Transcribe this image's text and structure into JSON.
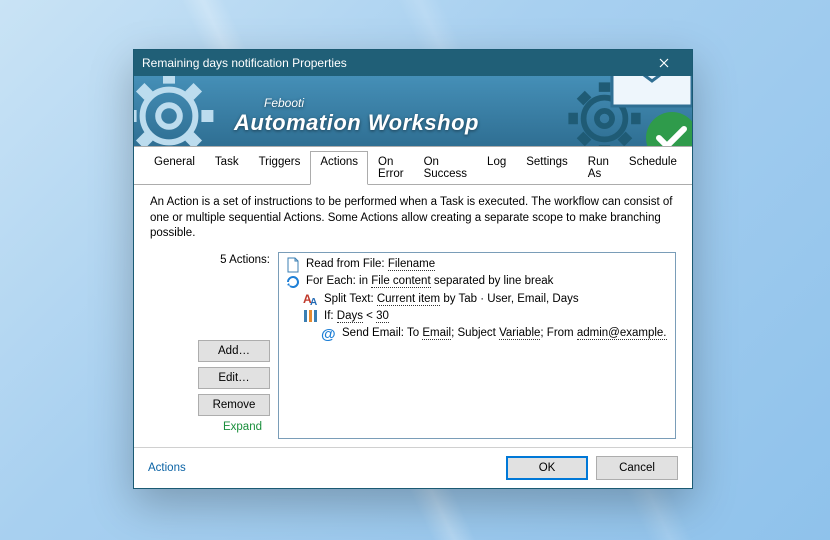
{
  "title": "Remaining days notification Properties",
  "brand": {
    "small": "Febooti",
    "big": "Automation Workshop"
  },
  "tabs": [
    "General",
    "Task",
    "Triggers",
    "Actions",
    "On Error",
    "On Success",
    "Log",
    "Settings",
    "Run As",
    "Schedule"
  ],
  "active_tab": 3,
  "description": "An Action is a set of instructions to be performed when a Task is executed. The workflow can consist of one or multiple sequential Actions. Some Actions allow creating a separate scope to make branching possible.",
  "actions_label": "5 Actions:",
  "side_buttons": {
    "add": "Add…",
    "edit": "Edit…",
    "remove": "Remove"
  },
  "expand": "Expand",
  "actions": [
    {
      "icon": "file",
      "parts": [
        {
          "t": "Read from File: "
        },
        {
          "t": "Filename",
          "dotted": true
        }
      ],
      "indent": 0
    },
    {
      "icon": "loop",
      "parts": [
        {
          "t": "For Each: in "
        },
        {
          "t": "File content",
          "dotted": true
        },
        {
          "t": " separated by line break"
        }
      ],
      "indent": 0
    },
    {
      "icon": "text",
      "parts": [
        {
          "t": "Split Text: "
        },
        {
          "t": "Current item",
          "dotted": true
        },
        {
          "t": " by Tab · User, Email, Days"
        }
      ],
      "indent": 1
    },
    {
      "icon": "if",
      "parts": [
        {
          "t": "If: "
        },
        {
          "t": "Days",
          "dotted": true
        },
        {
          "t": " < "
        },
        {
          "t": "30",
          "dotted": true
        }
      ],
      "indent": 1
    },
    {
      "icon": "email",
      "parts": [
        {
          "t": "Send Email: To "
        },
        {
          "t": "Email",
          "dotted": true
        },
        {
          "t": "; Subject "
        },
        {
          "t": "Variable",
          "dotted": true
        },
        {
          "t": "; From "
        },
        {
          "t": "admin@example.",
          "dotted": true
        }
      ],
      "indent": 2
    }
  ],
  "footer": {
    "help": "Actions",
    "ok": "OK",
    "cancel": "Cancel"
  }
}
